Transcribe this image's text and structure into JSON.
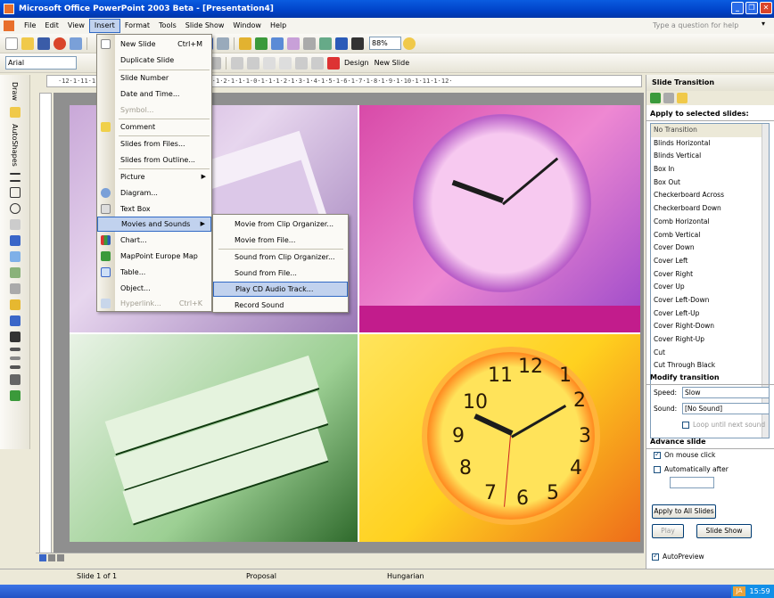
{
  "window": {
    "title": "Microsoft Office PowerPoint 2003 Beta - [Presentation4]"
  },
  "menubar": {
    "items": [
      "File",
      "Edit",
      "View",
      "Insert",
      "Format",
      "Tools",
      "Slide Show",
      "Window",
      "Help"
    ],
    "help_placeholder": "Type a question for help"
  },
  "toolbar": {
    "font": "Arial",
    "zoom": "88%",
    "design_label": "Design",
    "new_slide_label": "New Slide"
  },
  "ruler": {
    "text": "·12·1·11·1·10·1·9·1·8·1·7·1·6·1·5·1·4·1·3·1·2·1·1·1·0·1·1·1·2·1·3·1·4·1·5·1·6·1·7·1·8·1·9·1·10·1·11·1·12·"
  },
  "drawbar": {
    "draw_label": "Draw",
    "autoshapes_label": "AutoShapes"
  },
  "insert_menu": {
    "items": [
      {
        "label": "New Slide",
        "shortcut": "Ctrl+M"
      },
      {
        "label": "Duplicate Slide"
      },
      {
        "label": "Slide Number"
      },
      {
        "label": "Date and Time..."
      },
      {
        "label": "Symbol...",
        "disabled": true
      },
      {
        "label": "Comment"
      },
      {
        "label": "Slides from Files..."
      },
      {
        "label": "Slides from Outline..."
      },
      {
        "label": "Picture",
        "submenu": true
      },
      {
        "label": "Diagram..."
      },
      {
        "label": "Text Box"
      },
      {
        "label": "Movies and Sounds",
        "submenu": true,
        "highlighted": true
      },
      {
        "label": "Chart..."
      },
      {
        "label": "MapPoint Europe Map"
      },
      {
        "label": "Table..."
      },
      {
        "label": "Object..."
      },
      {
        "label": "Hyperlink...",
        "shortcut": "Ctrl+K",
        "disabled": true
      }
    ]
  },
  "movies_submenu": {
    "items": [
      {
        "label": "Movie from Clip Organizer..."
      },
      {
        "label": "Movie from File..."
      },
      {
        "label": "Sound from Clip Organizer..."
      },
      {
        "label": "Sound from File..."
      },
      {
        "label": "Play CD Audio Track...",
        "highlighted": true
      },
      {
        "label": "Record Sound"
      }
    ]
  },
  "slide": {
    "clock_numerals": [
      "11",
      "12",
      "1",
      "10",
      "2",
      "9",
      "3",
      "8",
      "4",
      "7",
      "6",
      "5"
    ]
  },
  "taskpane": {
    "title": "Slide Transition",
    "apply_heading": "Apply to selected slides:",
    "transitions": [
      "No Transition",
      "Blinds Horizontal",
      "Blinds Vertical",
      "Box In",
      "Box Out",
      "Checkerboard Across",
      "Checkerboard Down",
      "Comb Horizontal",
      "Comb Vertical",
      "Cover Down",
      "Cover Left",
      "Cover Right",
      "Cover Up",
      "Cover Left-Down",
      "Cover Left-Up",
      "Cover Right-Down",
      "Cover Right-Up",
      "Cut",
      "Cut Through Black"
    ],
    "modify_heading": "Modify transition",
    "speed_label": "Speed:",
    "speed_value": "Slow",
    "sound_label": "Sound:",
    "sound_value": "[No Sound]",
    "loop_label": "Loop until next sound",
    "advance_heading": "Advance slide",
    "on_mouse_click": "On mouse click",
    "auto_after": "Automatically after",
    "apply_all": "Apply to All Slides",
    "play": "Play",
    "slide_show": "Slide Show",
    "autopreview": "AutoPreview"
  },
  "statusbar": {
    "slide": "Slide 1 of 1",
    "design": "Proposal",
    "language": "Hungarian"
  },
  "taskbar": {
    "lang": "JA",
    "time": "15:59"
  }
}
